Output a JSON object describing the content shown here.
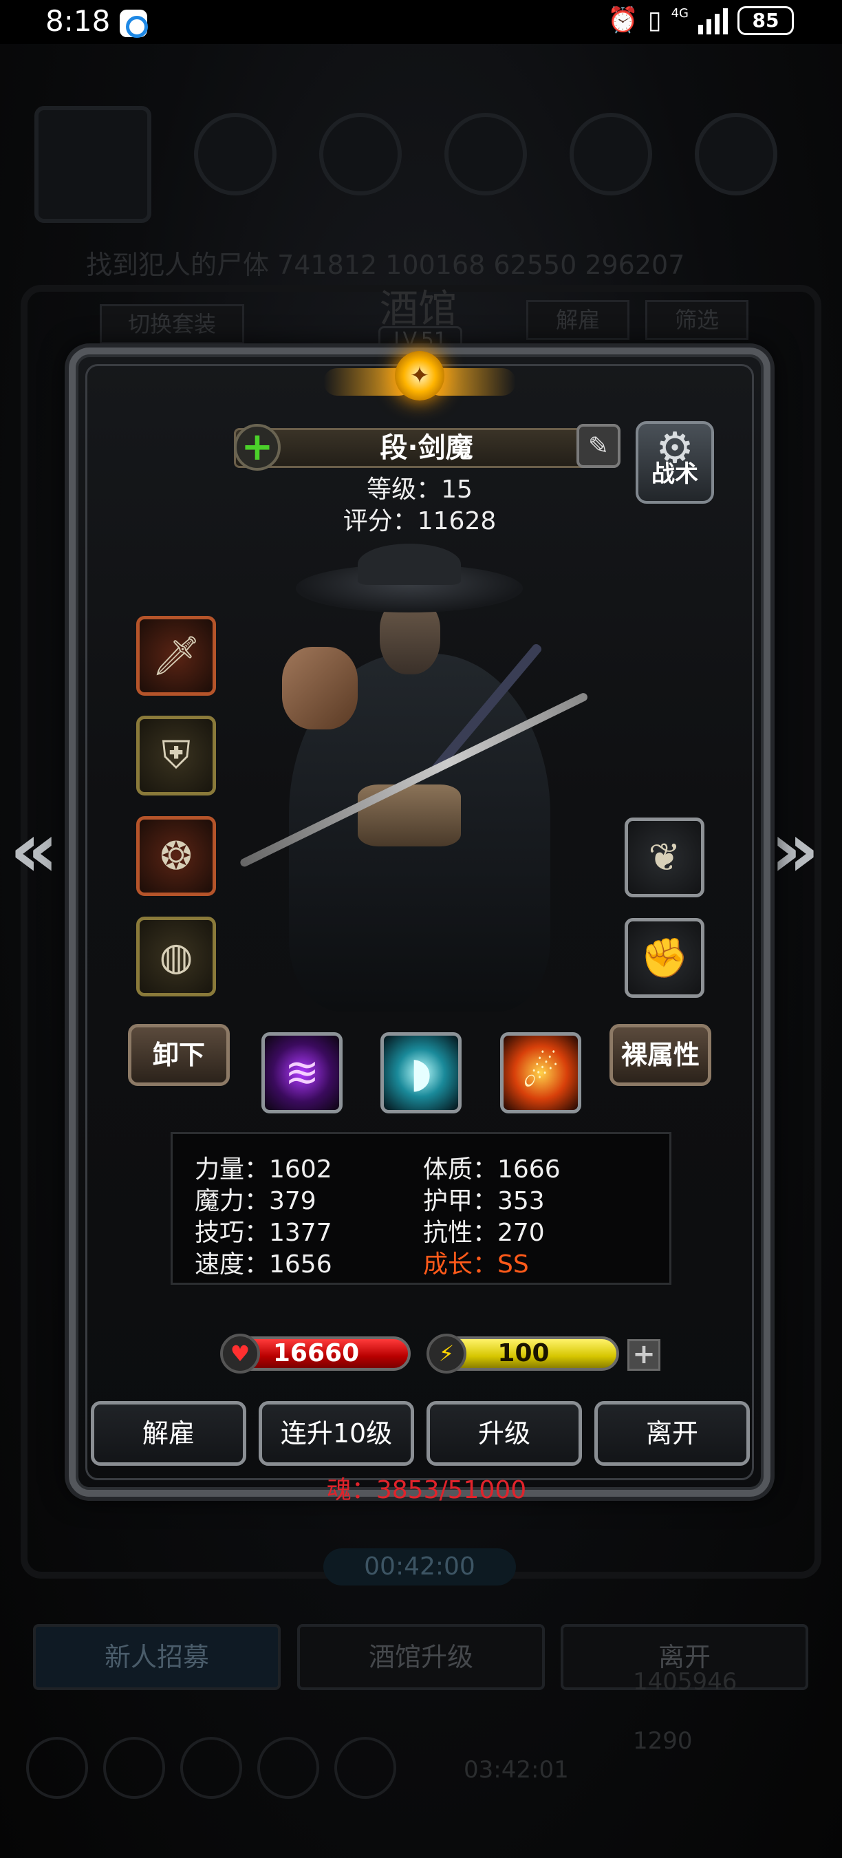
{
  "status_bar": {
    "time": "8:18",
    "network": "4G",
    "battery": "85",
    "icons": [
      "app-notification-icon",
      "alarm-icon",
      "vibrate-icon",
      "signal-icon",
      "battery-icon"
    ]
  },
  "background": {
    "quest_text": "找到犯人的尸体  741812   100168   62550   296207",
    "tavern_title": "酒馆",
    "tavern_level": "LV.51",
    "switch_outfit": "切换套装",
    "dismiss": "解雇",
    "filter": "筛选",
    "timer": "00:42:00",
    "tabs": [
      "新人招募",
      "酒馆升级",
      "离开"
    ],
    "gift_timer": "03:42:01",
    "gold": "1405946",
    "gems": "1290"
  },
  "hero": {
    "name": "段·剑魔",
    "level_text": "等级：15",
    "score_text": "评分：11628",
    "tactics_label": "战术"
  },
  "equipment": {
    "left_slots": [
      "sword-icon",
      "chest-armor-icon",
      "amulet-icon",
      "ring-icon"
    ],
    "right_slots": [
      "feather-icon",
      "gauntlet-icon"
    ],
    "skills": [
      "claw-slash-skill-icon",
      "wind-slash-skill-icon",
      "fire-slash-skill-icon"
    ],
    "unequip_label": "卸下",
    "base_attr_label": "裸属性"
  },
  "stats": {
    "strength": "力量：1602",
    "magic": "魔力：379",
    "skill": "技巧：1377",
    "speed": "速度：1656",
    "constitution": "体质：1666",
    "armor": "护甲：353",
    "resistance": "抗性：270",
    "growth": "成长：SS"
  },
  "bars": {
    "hp": "16660",
    "mp": "100",
    "add_label": "+"
  },
  "actions": {
    "dismiss": "解雇",
    "level_up_10": "连升10级",
    "level_up": "升级",
    "leave": "离开"
  },
  "soul_text": "魂：3853/51000",
  "colors": {
    "growth": "#ff5a1a",
    "soul": "#e0232b",
    "hp": "#d61a1a",
    "mp": "#e6d400",
    "add_green": "#4bd12a"
  }
}
